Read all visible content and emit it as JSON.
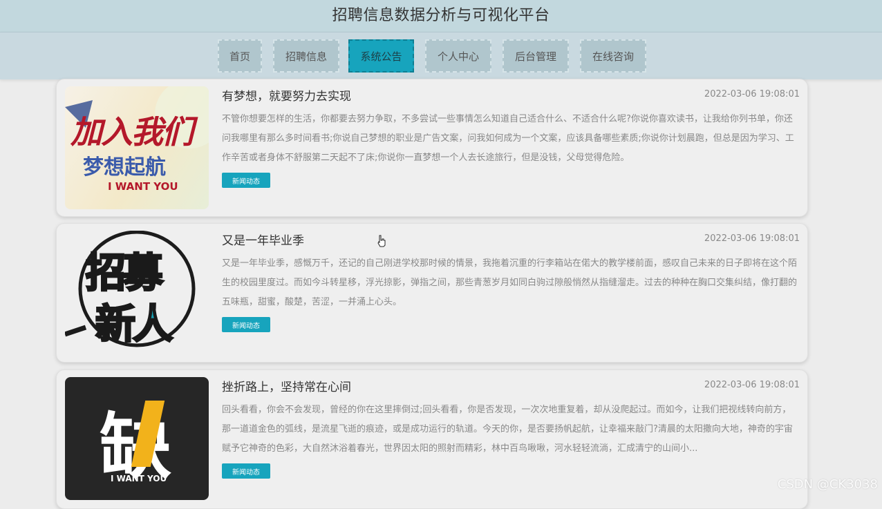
{
  "header": {
    "title": "招聘信息数据分析与可视化平台"
  },
  "nav": {
    "items": [
      {
        "label": "首页"
      },
      {
        "label": "招聘信息"
      },
      {
        "label": "系统公告",
        "active": true
      },
      {
        "label": "个人中心"
      },
      {
        "label": "后台管理"
      },
      {
        "label": "在线咨询"
      }
    ]
  },
  "posts": [
    {
      "title": "有梦想，就要努力去实现",
      "time": "2022-03-06 19:08:01",
      "body": "不管你想要怎样的生活，你都要去努力争取，不多尝试一些事情怎么知道自己适合什么、不适合什么呢?你说你喜欢读书，让我给你列书单，你还问我哪里有那么多时间看书;你说自己梦想的职业是广告文案，问我如何成为一个文案，应该具备哪些素质;你说你计划晨跑，但总是因为学习、工作辛苦或者身体不舒服第二天起不了床;你说你一直梦想一个人去长途旅行，但是没钱，父母觉得危险。",
      "tag": "新闻动态",
      "image": {
        "line1": "加入我们",
        "line2": "梦想起航",
        "caption": "I WANT YOU"
      }
    },
    {
      "title": "又是一年毕业季",
      "time": "2022-03-06 19:08:01",
      "body": "又是一年毕业季，感慨万千，还记的自己刚进学校那时候的情景，我拖着沉重的行李箱站在偌大的教学楼前面，感叹自己未来的日子即将在这个陌生的校园里度过。而如今斗转星移，浮光掠影，弹指之间，那些青葱岁月如同白驹过隙般悄然从指缝溜走。过去的种种在胸口交集纠结，像打翻的五味瓶，甜蜜，酸楚，苦涩，一并涌上心头。",
      "tag": "新闻动态",
      "image": {
        "line1": "招募",
        "line2": "新人"
      }
    },
    {
      "title": "挫折路上，坚持常在心间",
      "time": "2022-03-06 19:08:01",
      "body": "回头看看，你会不会发现，曾经的你在这里摔倒过;回头看看，你是否发现，一次次地重复着，却从没爬起过。而如今，让我们把视线转向前方，那一道道金色的弧线，是流星飞逝的痕迹，或是成功运行的轨道。今天的你，是否要扬帆起航，让幸福来敲门?清晨的太阳撒向大地，神奇的宇宙赋予它神奇的色彩，大自然沐浴着春光，世界因太阳的照射而精彩，林中百鸟啾啾，河水轻轻流淌，汇成清宁的山间小...",
      "tag": "新闻动态",
      "image": {
        "big": "缺",
        "caption": "I WANT YOU"
      }
    }
  ],
  "watermark": "CSDN @CK3038",
  "colors": {
    "accent": "#17a4bd",
    "header_bg": "#c2d8de",
    "nav_bg": "#c9d9e0"
  }
}
